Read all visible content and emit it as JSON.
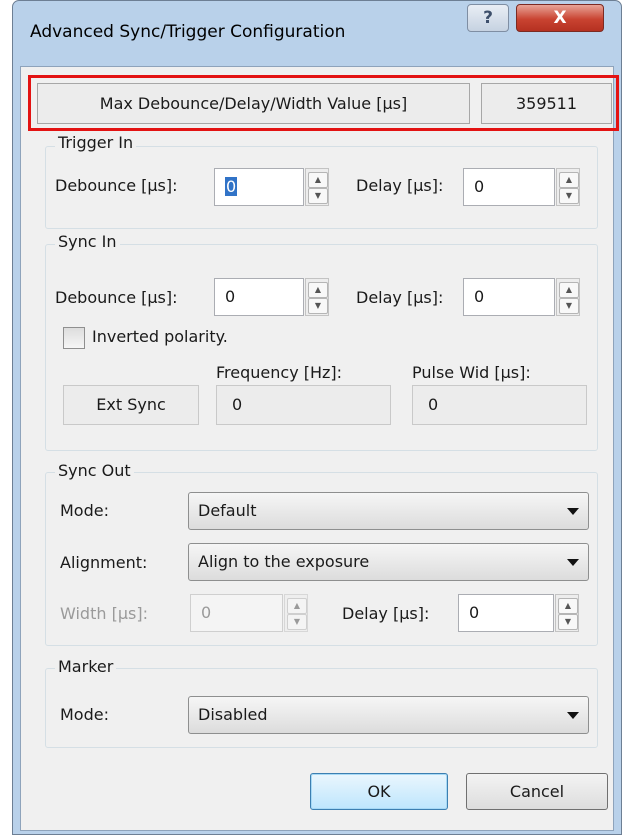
{
  "window": {
    "title": "Advanced Sync/Trigger Configuration",
    "help_label": "?",
    "close_label": "X"
  },
  "max_value": {
    "label": "Max Debounce/Delay/Width Value [µs]",
    "value": "359511"
  },
  "trigger_in": {
    "group_title": "Trigger In",
    "debounce_label": "Debounce [µs]:",
    "debounce_value": "0",
    "delay_label": "Delay [µs]:",
    "delay_value": "0"
  },
  "sync_in": {
    "group_title": "Sync In",
    "debounce_label": "Debounce [µs]:",
    "debounce_value": "0",
    "delay_label": "Delay [µs]:",
    "delay_value": "0",
    "inverted_label": "Inverted polarity.",
    "inverted_checked": false,
    "frequency_label": "Frequency [Hz]:",
    "pulse_label": "Pulse Wid [µs]:",
    "ext_sync_label": "Ext Sync",
    "frequency_value": "0",
    "pulse_value": "0"
  },
  "sync_out": {
    "group_title": "Sync Out",
    "mode_label": "Mode:",
    "mode_value": "Default",
    "alignment_label": "Alignment:",
    "alignment_value": "Align to the exposure",
    "width_label": "Width [µs]:",
    "width_value": "0",
    "delay_label": "Delay [µs]:",
    "delay_value": "0"
  },
  "marker": {
    "group_title": "Marker",
    "mode_label": "Mode:",
    "mode_value": "Disabled"
  },
  "buttons": {
    "ok": "OK",
    "cancel": "Cancel"
  },
  "colors": {
    "highlight": "#e31313",
    "dialog_bg": "#f0f0f0",
    "close_button": "#c94331"
  },
  "icons": {
    "spin_up": "spin-up-arrow-icon",
    "spin_down": "spin-down-arrow-icon",
    "dropdown": "dropdown-arrow-icon"
  }
}
